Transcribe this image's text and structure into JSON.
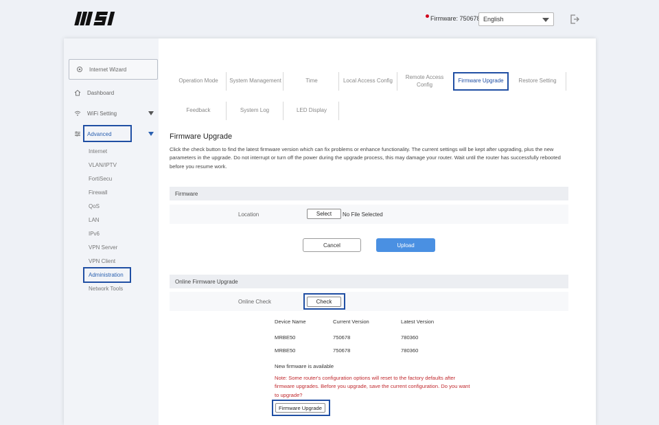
{
  "header": {
    "logo_text": "MSI",
    "firmware_label": "Firmware: 750678",
    "language": "English",
    "logout_icon": "logout-icon"
  },
  "sidebar": {
    "wizard_label": "Internet Wizard",
    "items": [
      {
        "label": "Dashboard",
        "icon": "home-icon"
      },
      {
        "label": "WiFi Setting",
        "icon": "wifi-icon"
      },
      {
        "label": "Advanced",
        "icon": "sliders-icon"
      }
    ],
    "sub_items": [
      "Internet",
      "VLAN/IPTV",
      "FortiSecu",
      "Firewall",
      "QoS",
      "LAN",
      "IPv6",
      "VPN Server",
      "VPN Client",
      "Administration",
      "Network Tools"
    ]
  },
  "tabs": {
    "row1": [
      "Operation Mode",
      "System Management",
      "Time",
      "Local Access Config",
      "Remote Access Config",
      "Firmware Upgrade",
      "Restore Setting"
    ],
    "row2": [
      "Feedback",
      "System Log",
      "LED Display"
    ]
  },
  "main": {
    "title": "Firmware Upgrade",
    "description": "Click the check button to find the latest firmware version which can fix problems or enhance functionality. The current settings will be kept after upgrading, plus the new parameters in the upgrade. Do not interrupt or turn off the power during the upgrade process, this may damage your router. Wait until the router has successfully rebooted before you resume work.",
    "firmware_section": {
      "header": "Firmware",
      "location_label": "Location",
      "select_button": "Select",
      "file_status": "No File Selected"
    },
    "cancel_button": "Cancel",
    "upload_button": "Upload",
    "online_section": {
      "header": "Online Firmware Upgrade",
      "online_check_label": "Online Check",
      "check_button": "Check",
      "table_headers": [
        "Device Name",
        "Current Version",
        "Latest Version"
      ],
      "rows": [
        [
          "MRBE50",
          "750678",
          "780360"
        ],
        [
          "MRBE50",
          "750678",
          "780360"
        ]
      ],
      "new_firmware": "New firmware is available",
      "note": "Note: Some router's configuration options will reset to the factory defaults after firmware upgrades. Before you upgrade, save the current configuration. Do you want to upgrade?",
      "upgrade_button": "Firmware Upgrade"
    }
  },
  "colors": {
    "accent": "#1f4ea3",
    "upload": "#4a90e2",
    "note": "#c0282d"
  }
}
